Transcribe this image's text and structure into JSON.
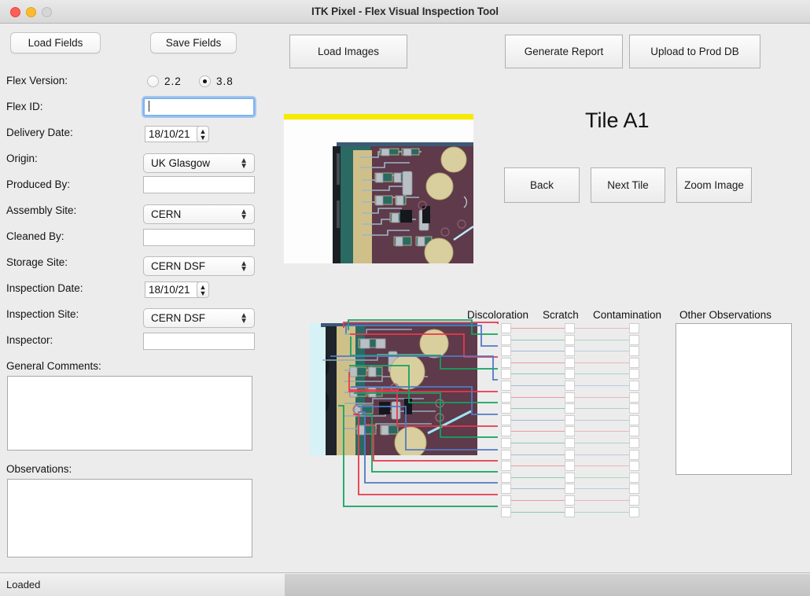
{
  "window": {
    "title": "ITK Pixel - Flex Visual Inspection Tool",
    "traffic_lights": [
      "close-button",
      "minimize-button",
      "maximize-button"
    ]
  },
  "toolbar": {
    "load_fields_label": "Load Fields",
    "save_fields_label": "Save Fields",
    "load_images_label": "Load Images",
    "generate_report_label": "Generate Report",
    "upload_to_prod_db_label": "Upload to Prod DB"
  },
  "form": {
    "flex_version": {
      "label": "Flex Version:",
      "options": [
        "2.2",
        "3.8"
      ],
      "selected": "3.8"
    },
    "flex_id": {
      "label": "Flex ID:",
      "value": "",
      "focused": true
    },
    "delivery_date": {
      "label": "Delivery Date:",
      "value": "18/10/21"
    },
    "origin": {
      "label": "Origin:",
      "value": "UK Glasgow"
    },
    "produced_by": {
      "label": "Produced By:",
      "value": ""
    },
    "assembly_site": {
      "label": "Assembly Site:",
      "value": "CERN"
    },
    "cleaned_by": {
      "label": "Cleaned By:",
      "value": ""
    },
    "storage_site": {
      "label": "Storage Site:",
      "value": "CERN DSF"
    },
    "inspection_date": {
      "label": "Inspection Date:",
      "value": "18/10/21"
    },
    "inspection_site": {
      "label": "Inspection Site:",
      "value": "CERN DSF"
    },
    "inspector": {
      "label": "Inspector:",
      "value": ""
    },
    "general_comments": {
      "label": "General Comments:",
      "value": ""
    },
    "observations": {
      "label": "Observations:",
      "value": ""
    }
  },
  "tile": {
    "title": "Tile A1",
    "back_label": "Back",
    "next_tile_label": "Next Tile",
    "zoom_image_label": "Zoom Image"
  },
  "defects": {
    "columns": [
      "Discoloration",
      "Scratch",
      "Contamination",
      "Other Observations"
    ],
    "row_count": 17,
    "other_observations_value": "",
    "line_colors": [
      "#e8394a",
      "#13a361",
      "#5379c4"
    ]
  },
  "statusbar": {
    "text": "Loaded"
  },
  "colors": {
    "window_bg": "#ececec",
    "focus_ring": "#7eb3f0",
    "accent_yellow": "#f5ea00",
    "pcb_green": "#2a6a63",
    "pcb_maroon": "#5e3a4a",
    "pcb_gold": "#cfc08a"
  }
}
